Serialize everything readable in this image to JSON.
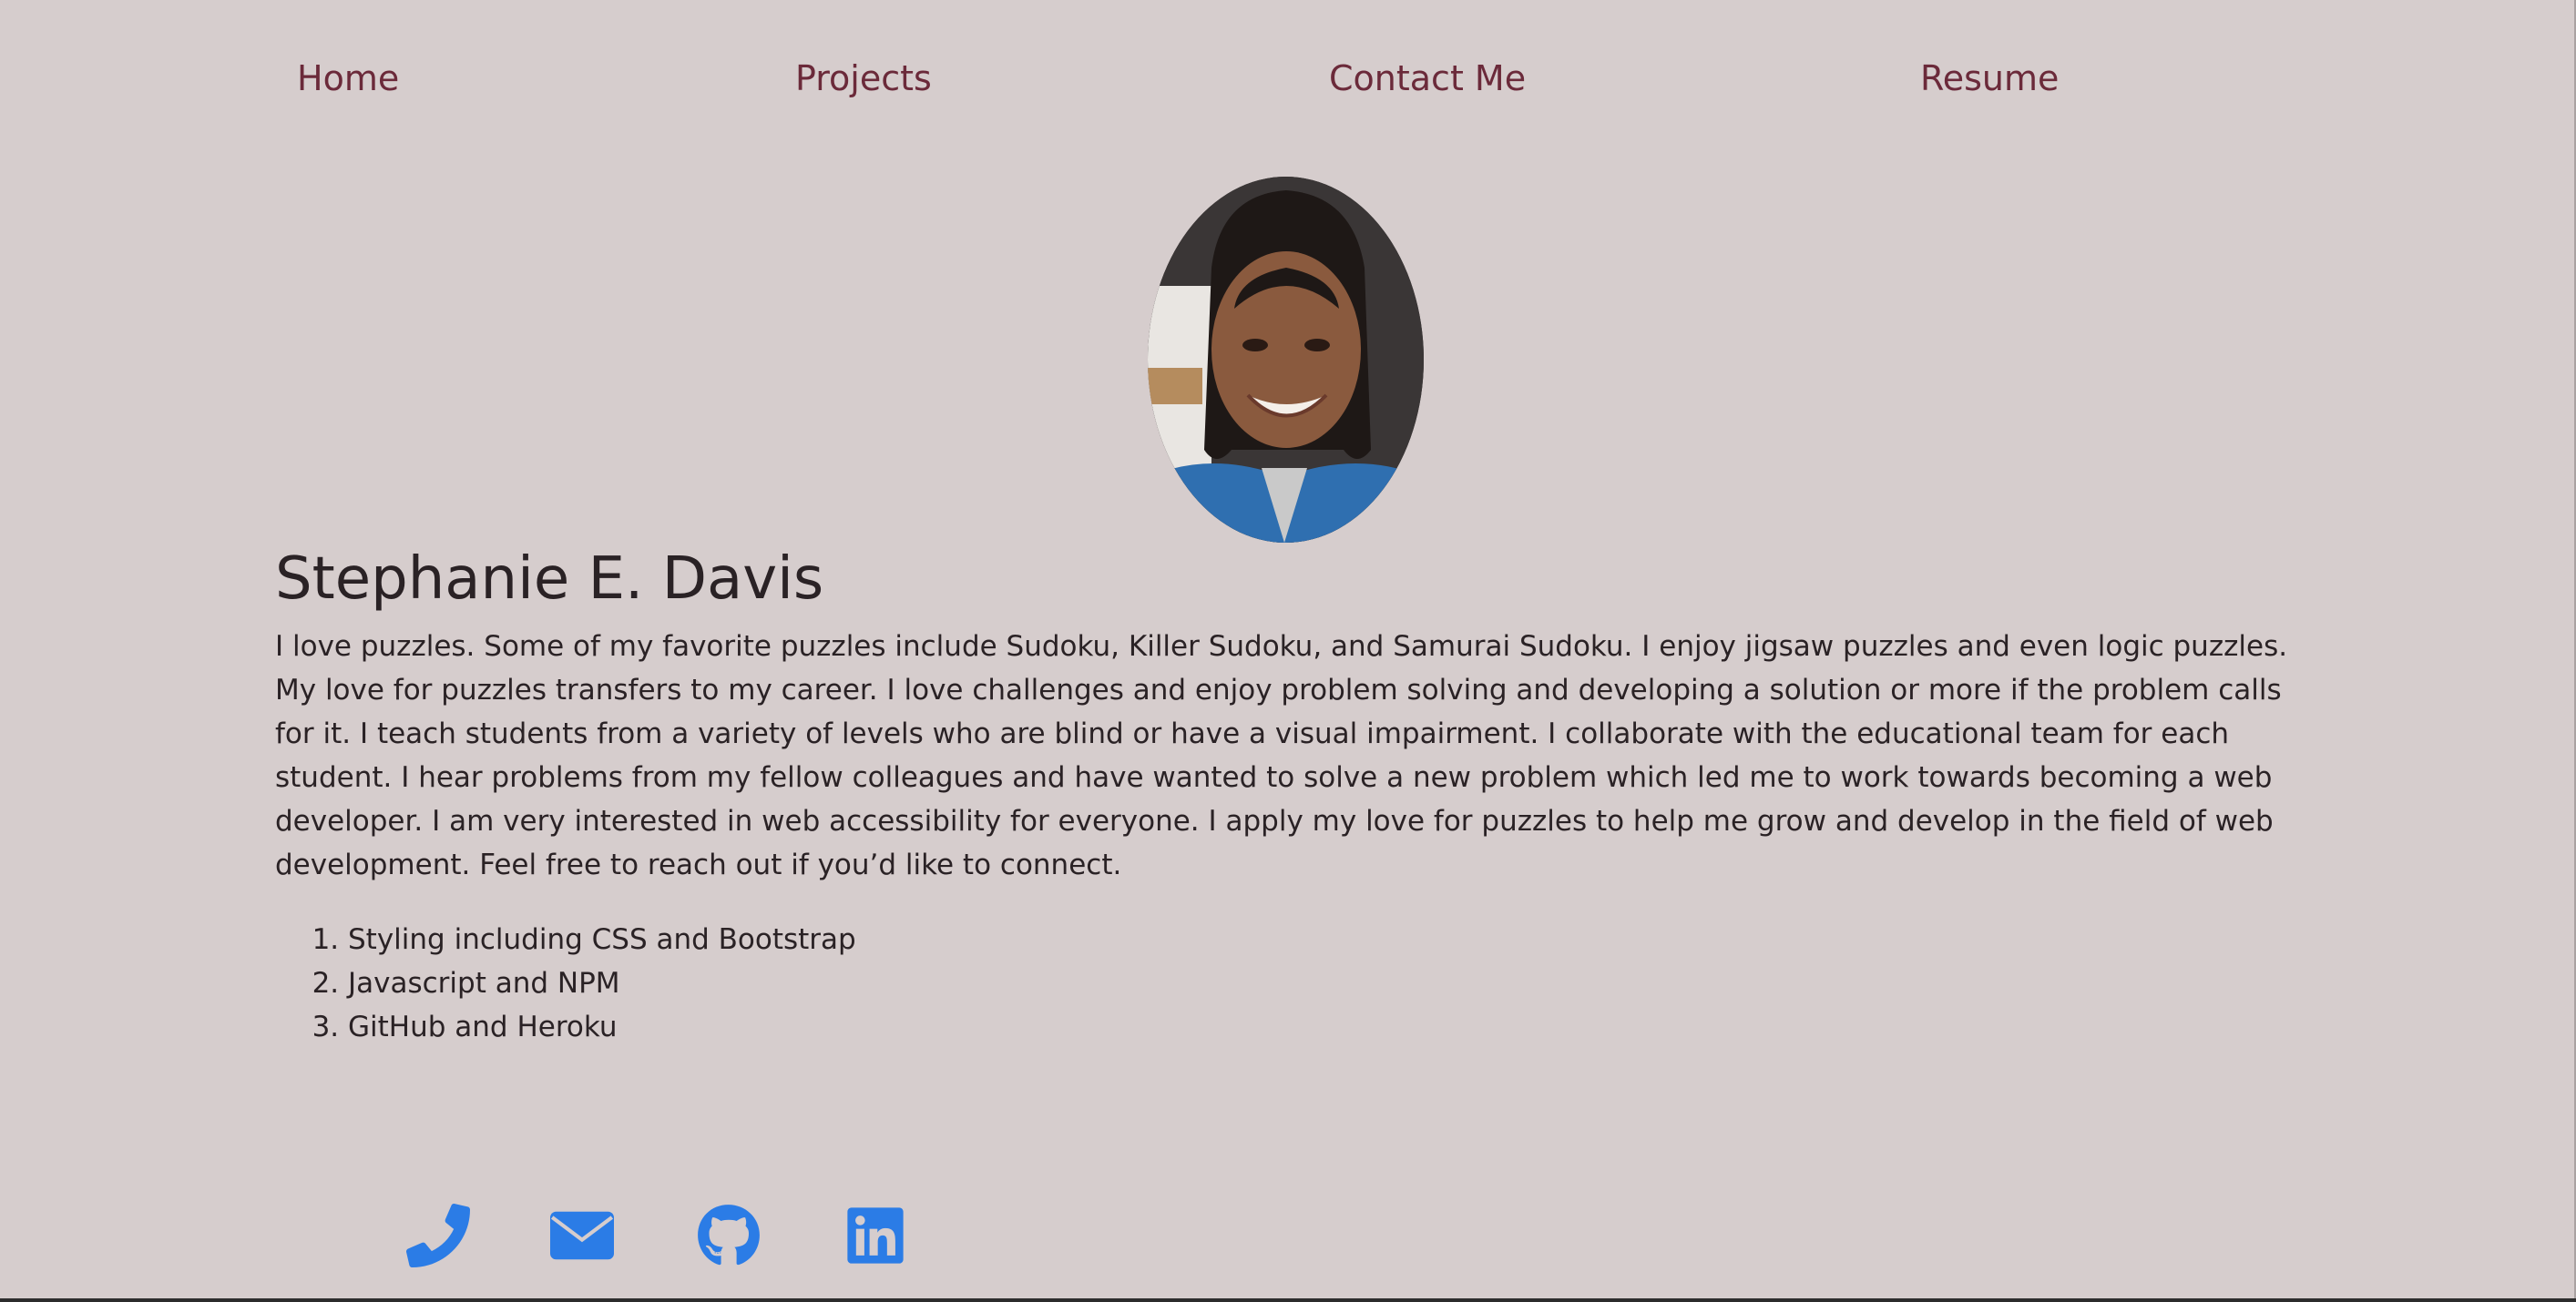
{
  "nav": {
    "home": "Home",
    "projects": "Projects",
    "contact": "Contact Me",
    "resume": "Resume"
  },
  "profile": {
    "name": "Stephanie E. Davis",
    "bio": "I love puzzles. Some of my favorite puzzles include Sudoku, Killer Sudoku, and Samurai Sudoku. I enjoy jigsaw puzzles and even logic puzzles. My love for puzzles transfers to my career. I love challenges and enjoy problem solving and developing a solution or more if the problem calls for it. I teach students from a variety of levels who are blind or have a visual impairment. I collaborate with the educational team for each student. I hear problems from my fellow colleagues and have wanted to solve a new problem which led me to work towards becoming a web developer. I am very interested in web accessibility for everyone. I apply my love for puzzles to help me grow and develop in the field of web development. Feel free to reach out if you’d like to connect.",
    "skills": [
      "Styling including CSS and Bootstrap",
      "Javascript and NPM",
      "GitHub and Heroku"
    ]
  },
  "social": {
    "icons": [
      "phone-icon",
      "envelope-icon",
      "github-icon",
      "linkedin-icon"
    ],
    "icon_color": "#2b7ce6"
  },
  "colors": {
    "background": "#d6cdcd",
    "nav_link": "#6b2a3a",
    "text": "#2a2225"
  }
}
